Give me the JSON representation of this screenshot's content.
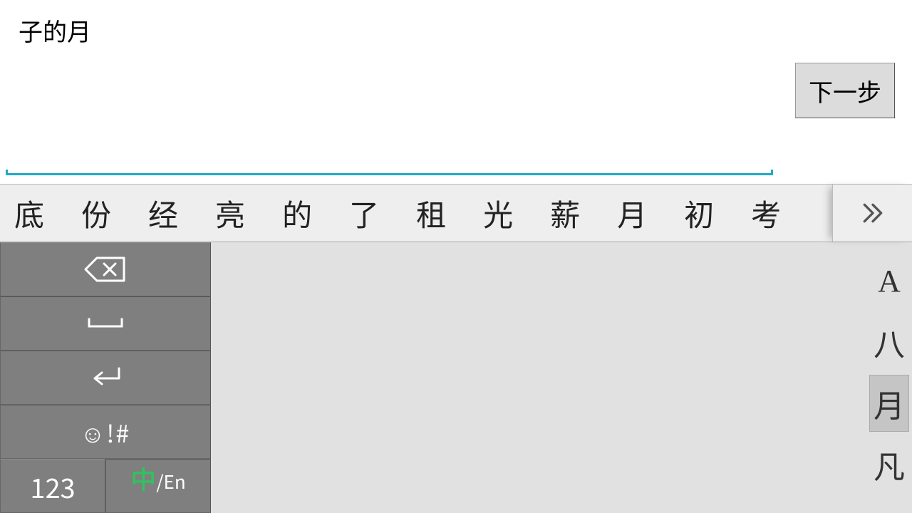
{
  "input": {
    "text": "子的月"
  },
  "next_button": {
    "label": "下一步"
  },
  "candidates": [
    "底",
    "份",
    "经",
    "亮",
    "的",
    "了",
    "租",
    "光",
    "薪",
    "月",
    "初",
    "考"
  ],
  "left_panel": {
    "numeric_label": "123",
    "lang_zh": "中",
    "lang_en": "/En",
    "emoji_label": "☺!#"
  },
  "right_strip": {
    "items": [
      "A",
      "八",
      "月",
      "凡"
    ],
    "active_index": 2
  }
}
